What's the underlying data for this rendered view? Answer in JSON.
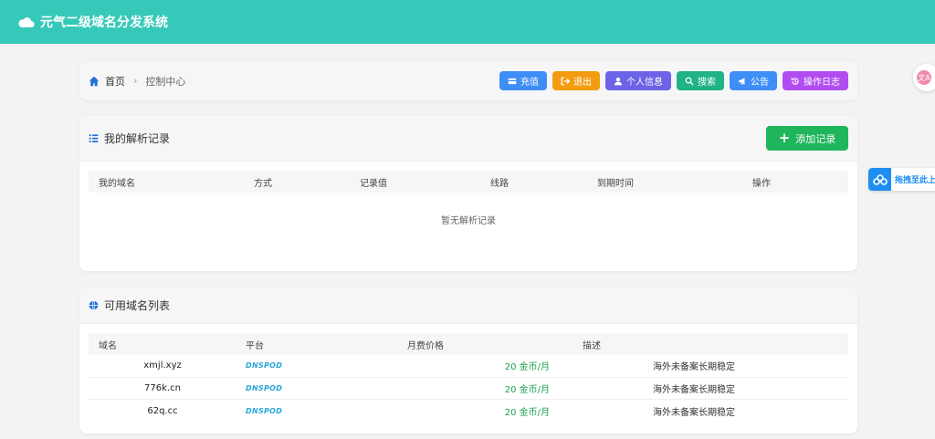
{
  "app": {
    "title": "元气二级域名分发系统"
  },
  "breadcrumb": {
    "home": "首页",
    "current": "控制中心"
  },
  "toolbar": {
    "buttons": [
      {
        "label": "充值",
        "icon": "credit-card-icon",
        "color": "#3e8ef7"
      },
      {
        "label": "退出",
        "icon": "sign-out-icon",
        "color": "#f39c12"
      },
      {
        "label": "个人信息",
        "icon": "user-icon",
        "color": "#6c63e6"
      },
      {
        "label": "搜索",
        "icon": "search-icon",
        "color": "#1fb387"
      },
      {
        "label": "公告",
        "icon": "bullhorn-icon",
        "color": "#3e8ef7"
      },
      {
        "label": "操作日志",
        "icon": "history-icon",
        "color": "#b14df0"
      }
    ]
  },
  "records": {
    "title": "我的解析记录",
    "add_label": "添加记录",
    "columns": [
      "我的域名",
      "方式",
      "记录值",
      "线路",
      "到期时间",
      "操作"
    ],
    "empty_text": "暂无解析记录"
  },
  "domains": {
    "title": "可用域名列表",
    "columns": [
      "域名",
      "平台",
      "月费价格",
      "描述"
    ],
    "rows": [
      {
        "name": "xmjl.xyz",
        "platform": "DNSPOD",
        "price": "20 金币/月",
        "desc": "海外未备案长期稳定"
      },
      {
        "name": "776k.cn",
        "platform": "DNSPOD",
        "price": "20 金币/月",
        "desc": "海外未备案长期稳定"
      },
      {
        "name": "62q.cc",
        "platform": "DNSPOD",
        "price": "20 金币/月",
        "desc": "海外未备案长期稳定"
      }
    ]
  },
  "widgets": {
    "translate_icon": "文A",
    "drag_label": "拖拽至此上"
  },
  "colors": {
    "topbar": "#36c9b9",
    "add_button": "#1fb55a",
    "price": "#1aa34a"
  }
}
